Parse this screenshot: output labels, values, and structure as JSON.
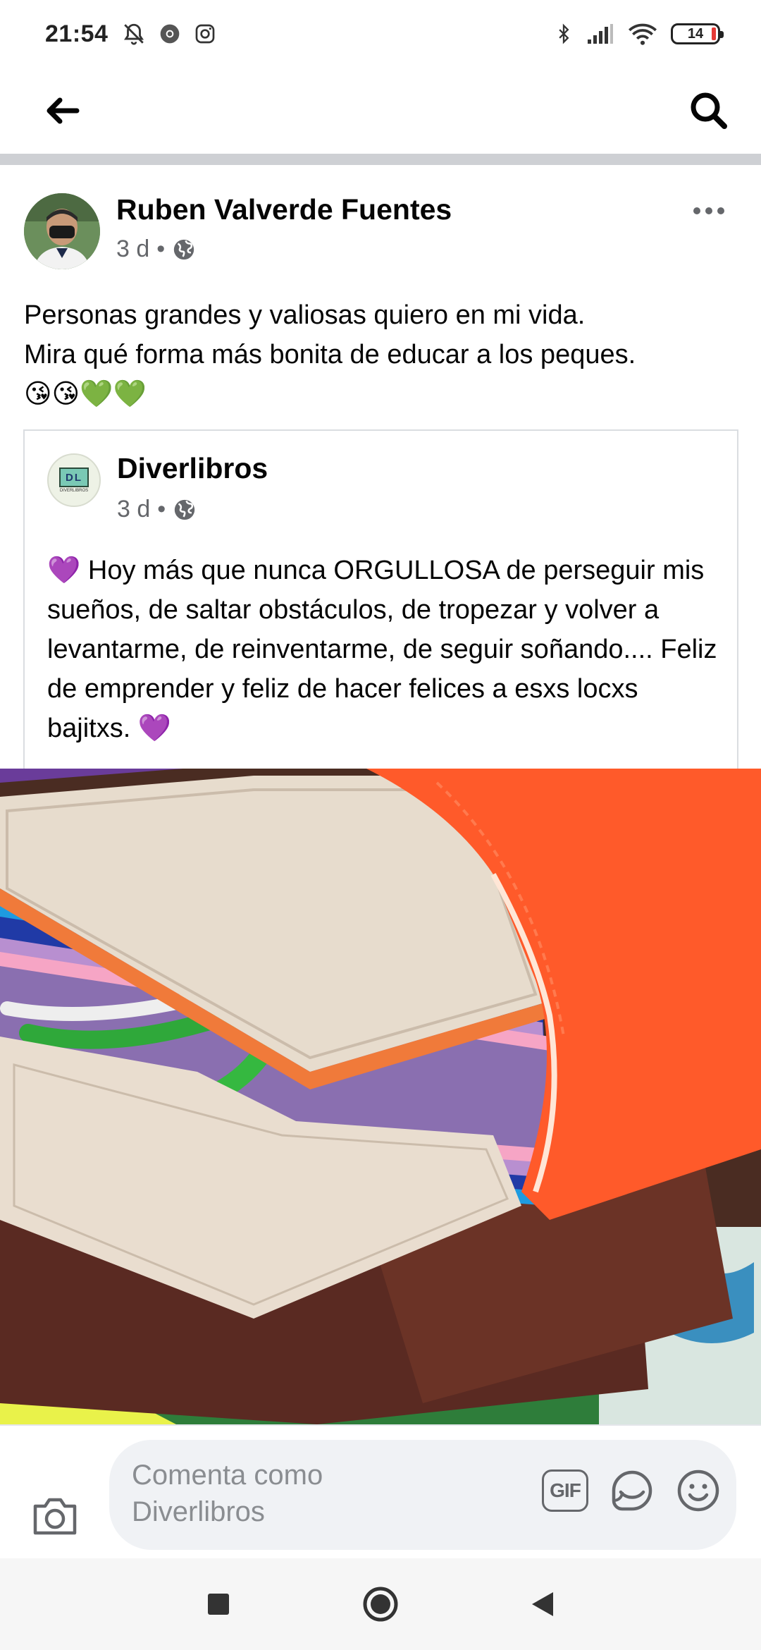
{
  "status_bar": {
    "time": "21:54",
    "battery": "14"
  },
  "app_bar": {
    "back_icon": "arrow-left-icon",
    "search_icon": "search-icon"
  },
  "post": {
    "author": "Ruben Valverde Fuentes",
    "time": "3 d",
    "separator": "•",
    "text_line1": "Personas grandes y valiosas quiero en mi vida.",
    "text_line2": "Mira qué forma más bonita de educar a los peques.",
    "emojis": "😘😘💚💚",
    "shared": {
      "page_name": "Diverlibros",
      "logo_text": "DL",
      "logo_sub": "DIVERLIBROS",
      "time": "3 d",
      "separator": "•",
      "text_start": "💜",
      "text": " Hoy más que nunca ORGULLOSA de perseguir mis sueños, de saltar obstáculos, de tropezar y volver a levantarme, de reinventarme, de seguir soñando.... Feliz de emprender y feliz de hacer felices a esxs locxs bajitxs. ",
      "text_end": "💜"
    }
  },
  "comment_bar": {
    "placeholder": "Comenta como Diverlibros",
    "gif_label": "GIF"
  },
  "colors": {
    "secondary_text": "#65676b",
    "divider": "#ced0d4",
    "input_bg": "#f0f2f5"
  }
}
